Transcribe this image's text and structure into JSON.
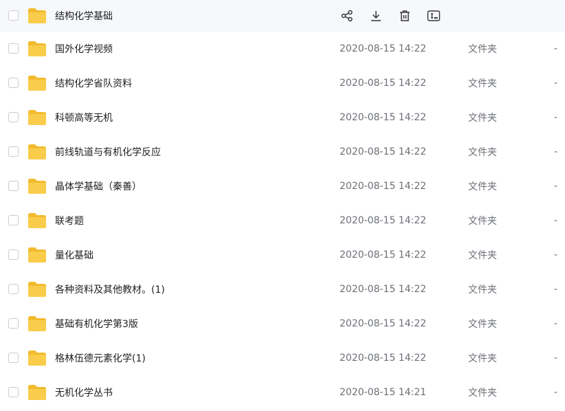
{
  "colors": {
    "folder": "#f9cd4b",
    "folder_tab": "#f2bb2e",
    "hover_bg": "#f6f8fb"
  },
  "hover_row": {
    "name": "结构化学基础",
    "actions": [
      {
        "icon": "share-icon"
      },
      {
        "icon": "download-icon"
      },
      {
        "icon": "delete-icon"
      },
      {
        "icon": "more-icon"
      }
    ]
  },
  "rows": [
    {
      "name": "国外化学视频",
      "date": "2020-08-15 14:22",
      "type": "文件夹",
      "size": "-"
    },
    {
      "name": "结构化学省队资料",
      "date": "2020-08-15 14:22",
      "type": "文件夹",
      "size": "-"
    },
    {
      "name": "科顿高等无机",
      "date": "2020-08-15 14:22",
      "type": "文件夹",
      "size": "-"
    },
    {
      "name": "前线轨道与有机化学反应",
      "date": "2020-08-15 14:22",
      "type": "文件夹",
      "size": "-"
    },
    {
      "name": "晶体学基础（秦善）",
      "date": "2020-08-15 14:22",
      "type": "文件夹",
      "size": "-"
    },
    {
      "name": "联考题",
      "date": "2020-08-15 14:22",
      "type": "文件夹",
      "size": "-"
    },
    {
      "name": "量化基础",
      "date": "2020-08-15 14:22",
      "type": "文件夹",
      "size": "-"
    },
    {
      "name": "各种资料及其他教材。(1)",
      "date": "2020-08-15 14:22",
      "type": "文件夹",
      "size": "-"
    },
    {
      "name": "基础有机化学第3版",
      "date": "2020-08-15 14:22",
      "type": "文件夹",
      "size": "-"
    },
    {
      "name": "格林伍德元素化学(1)",
      "date": "2020-08-15 14:22",
      "type": "文件夹",
      "size": "-"
    },
    {
      "name": "无机化学丛书",
      "date": "2020-08-15 14:21",
      "type": "文件夹",
      "size": "-"
    }
  ]
}
